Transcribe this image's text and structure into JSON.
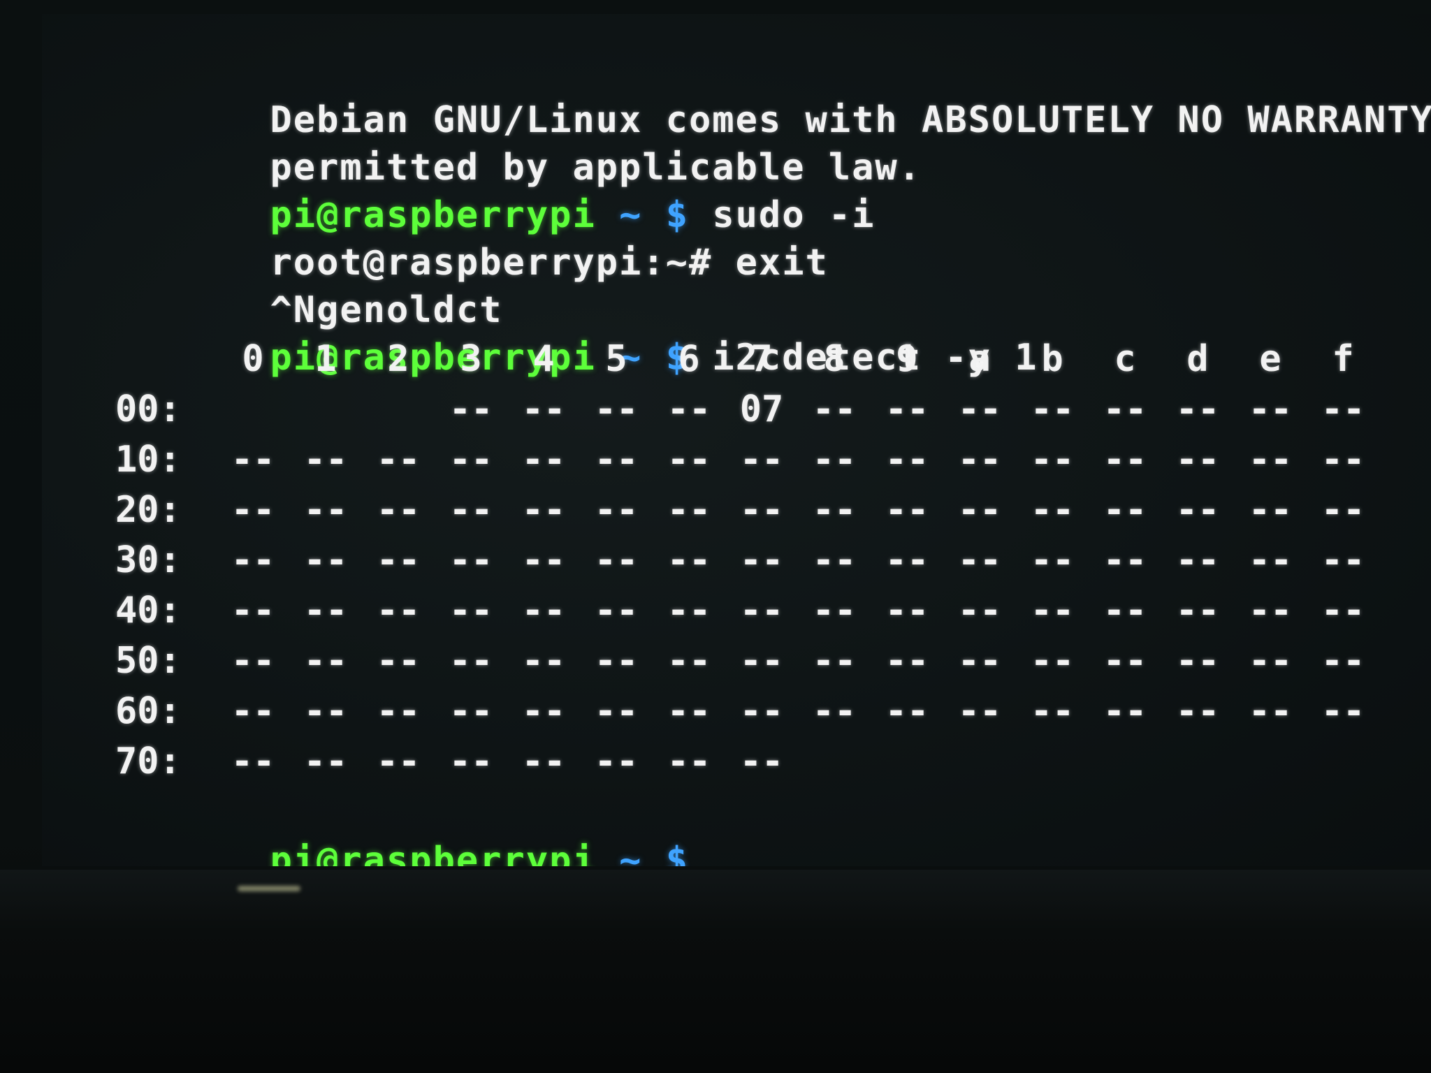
{
  "terminal": {
    "lines": {
      "warranty_1": "Debian GNU/Linux comes with ABSOLUTELY NO WARRANTY, to t",
      "warranty_2": "permitted by applicable law.",
      "prompt_user": "pi@raspberrypi",
      "prompt_tilde": "~",
      "prompt_dollar": "$",
      "cmd_sudo": "sudo -i",
      "root_prompt": "root@raspberrypi:~#",
      "cmd_exit": "exit",
      "garbled": "^Ngenoldct",
      "cmd_i2c": "i2cdetect -y 1"
    },
    "i2c": {
      "header": [
        "0",
        "1",
        "2",
        "3",
        "4",
        "5",
        "6",
        "7",
        "8",
        "9",
        "a",
        "b",
        "c",
        "d",
        "e",
        "f"
      ],
      "rows": [
        {
          "label": "00:",
          "cells": [
            "",
            "",
            "",
            "--",
            "--",
            "--",
            "--",
            "07",
            "--",
            "--",
            "--",
            "--",
            "--",
            "--",
            "--",
            "--"
          ]
        },
        {
          "label": "10:",
          "cells": [
            "--",
            "--",
            "--",
            "--",
            "--",
            "--",
            "--",
            "--",
            "--",
            "--",
            "--",
            "--",
            "--",
            "--",
            "--",
            "--"
          ]
        },
        {
          "label": "20:",
          "cells": [
            "--",
            "--",
            "--",
            "--",
            "--",
            "--",
            "--",
            "--",
            "--",
            "--",
            "--",
            "--",
            "--",
            "--",
            "--",
            "--"
          ]
        },
        {
          "label": "30:",
          "cells": [
            "--",
            "--",
            "--",
            "--",
            "--",
            "--",
            "--",
            "--",
            "--",
            "--",
            "--",
            "--",
            "--",
            "--",
            "--",
            "--"
          ]
        },
        {
          "label": "40:",
          "cells": [
            "--",
            "--",
            "--",
            "--",
            "--",
            "--",
            "--",
            "--",
            "--",
            "--",
            "--",
            "--",
            "--",
            "--",
            "--",
            "--"
          ]
        },
        {
          "label": "50:",
          "cells": [
            "--",
            "--",
            "--",
            "--",
            "--",
            "--",
            "--",
            "--",
            "--",
            "--",
            "--",
            "--",
            "--",
            "--",
            "--",
            "--"
          ]
        },
        {
          "label": "60:",
          "cells": [
            "--",
            "--",
            "--",
            "--",
            "--",
            "--",
            "--",
            "--",
            "--",
            "--",
            "--",
            "--",
            "--",
            "--",
            "--",
            "--"
          ]
        },
        {
          "label": "70:",
          "cells": [
            "--",
            "--",
            "--",
            "--",
            "--",
            "--",
            "--",
            "--"
          ]
        }
      ]
    },
    "colors": {
      "prompt_user": "#5dff3a",
      "prompt_dollar": "#3fa3ff",
      "text": "#f2f2f2",
      "background": "#0e1415"
    }
  }
}
